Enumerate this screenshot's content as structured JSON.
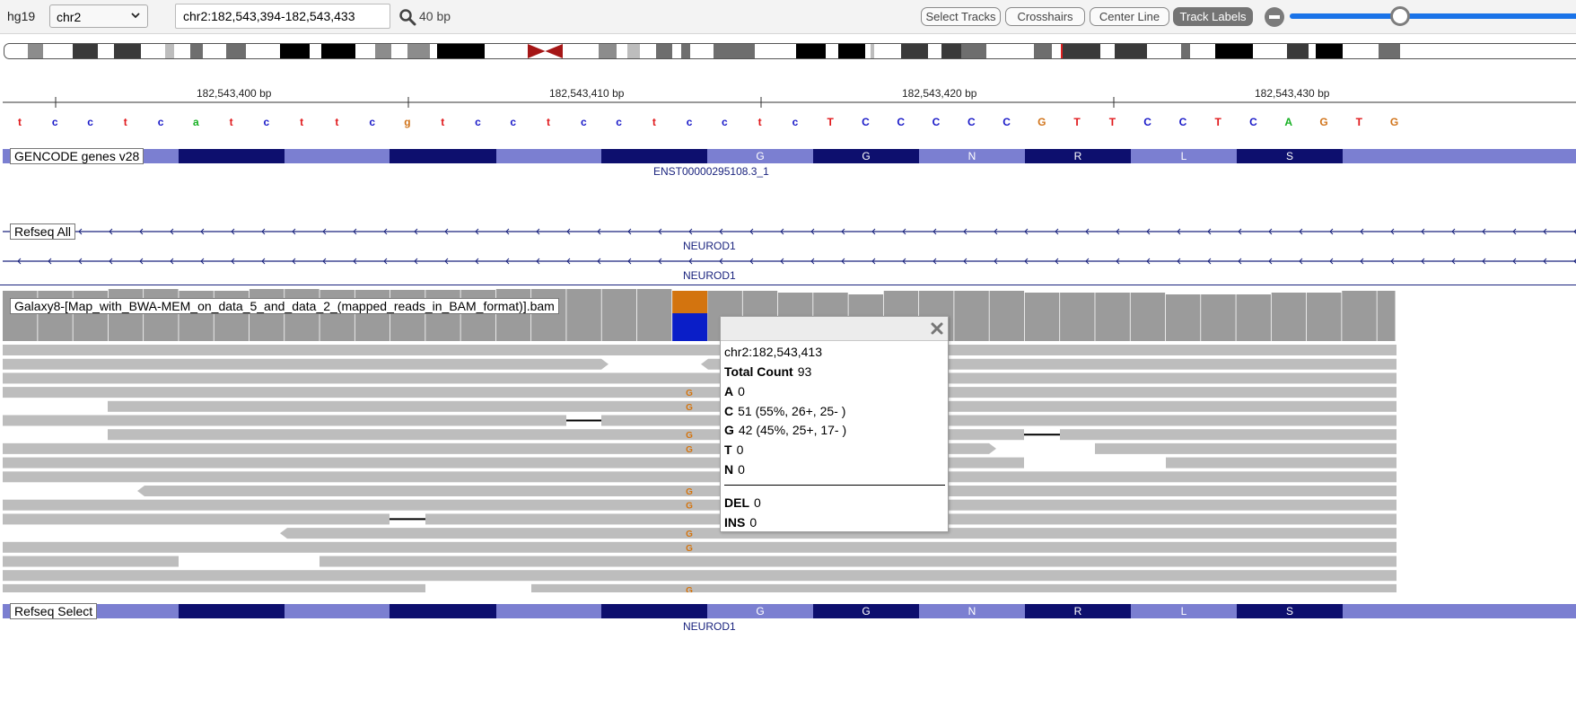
{
  "toolbar": {
    "genome": "hg19",
    "chromosome": "chr2",
    "locus": "chr2:182,543,394-182,543,433",
    "window_size": "40 bp",
    "buttons": {
      "select_tracks": "Select Tracks",
      "crosshairs": "Crosshairs",
      "center_line": "Center Line",
      "track_labels": "Track Labels"
    },
    "active_button": "track_labels"
  },
  "ruler": {
    "labels": [
      "182,543,400 bp",
      "182,543,410 bp",
      "182,543,420 bp",
      "182,543,430 bp"
    ]
  },
  "sequence": {
    "bases": [
      "t",
      "c",
      "c",
      "t",
      "c",
      "a",
      "t",
      "c",
      "t",
      "t",
      "c",
      "g",
      "t",
      "c",
      "c",
      "t",
      "c",
      "c",
      "t",
      "c",
      "c",
      "t",
      "c",
      "T",
      "C",
      "C",
      "C",
      "C",
      "C",
      "G",
      "T",
      "T",
      "C",
      "C",
      "T",
      "C",
      "A",
      "G",
      "T",
      "G"
    ],
    "colors": {
      "A": "#15b022",
      "C": "#1919c8",
      "G": "#d1741b",
      "T": "#e0181b"
    }
  },
  "tracks": {
    "gencode": {
      "label": "GENCODE genes v28",
      "transcript": "ENST00000295108.3_1",
      "amino_acids": [
        "G",
        "G",
        "N",
        "R",
        "L",
        "S"
      ]
    },
    "refseq_all": {
      "label": "Refseq All",
      "gene1": "NEUROD1",
      "gene2": "NEUROD1"
    },
    "alignment": {
      "label": "Galaxy8-[Map_with_BWA-MEM_on_data_5_and_data_2_(mapped_reads_in_BAM_format)].bam",
      "mismatch_base": "G"
    },
    "refseq_select": {
      "label": "Refseq Select",
      "gene": "NEUROD1",
      "amino_acids": [
        "G",
        "G",
        "N",
        "R",
        "L",
        "S"
      ]
    }
  },
  "colors": {
    "exon_dark": "#0d0f6e",
    "exon_light": "#7b7fd1",
    "coverage": "#9b9b9b",
    "read": "#bdbdbd",
    "allele_C": "#0a1ec8",
    "allele_G": "#d3740f",
    "slider": "#1a73e8"
  },
  "popup": {
    "position": "chr2:182,543,413",
    "total_count": {
      "label": "Total Count",
      "value": "93"
    },
    "rows": [
      {
        "base": "A",
        "value": "0"
      },
      {
        "base": "C",
        "value": "51 (55%, 26+, 25- )"
      },
      {
        "base": "G",
        "value": "42 (45%, 25+, 17- )"
      },
      {
        "base": "T",
        "value": "0"
      },
      {
        "base": "N",
        "value": "0"
      }
    ],
    "del": {
      "label": "DEL",
      "value": "0"
    },
    "ins": {
      "label": "INS",
      "value": "0"
    }
  },
  "icons": [
    "chevron-down-icon",
    "search-icon",
    "zoom-out-icon",
    "close-icon"
  ]
}
